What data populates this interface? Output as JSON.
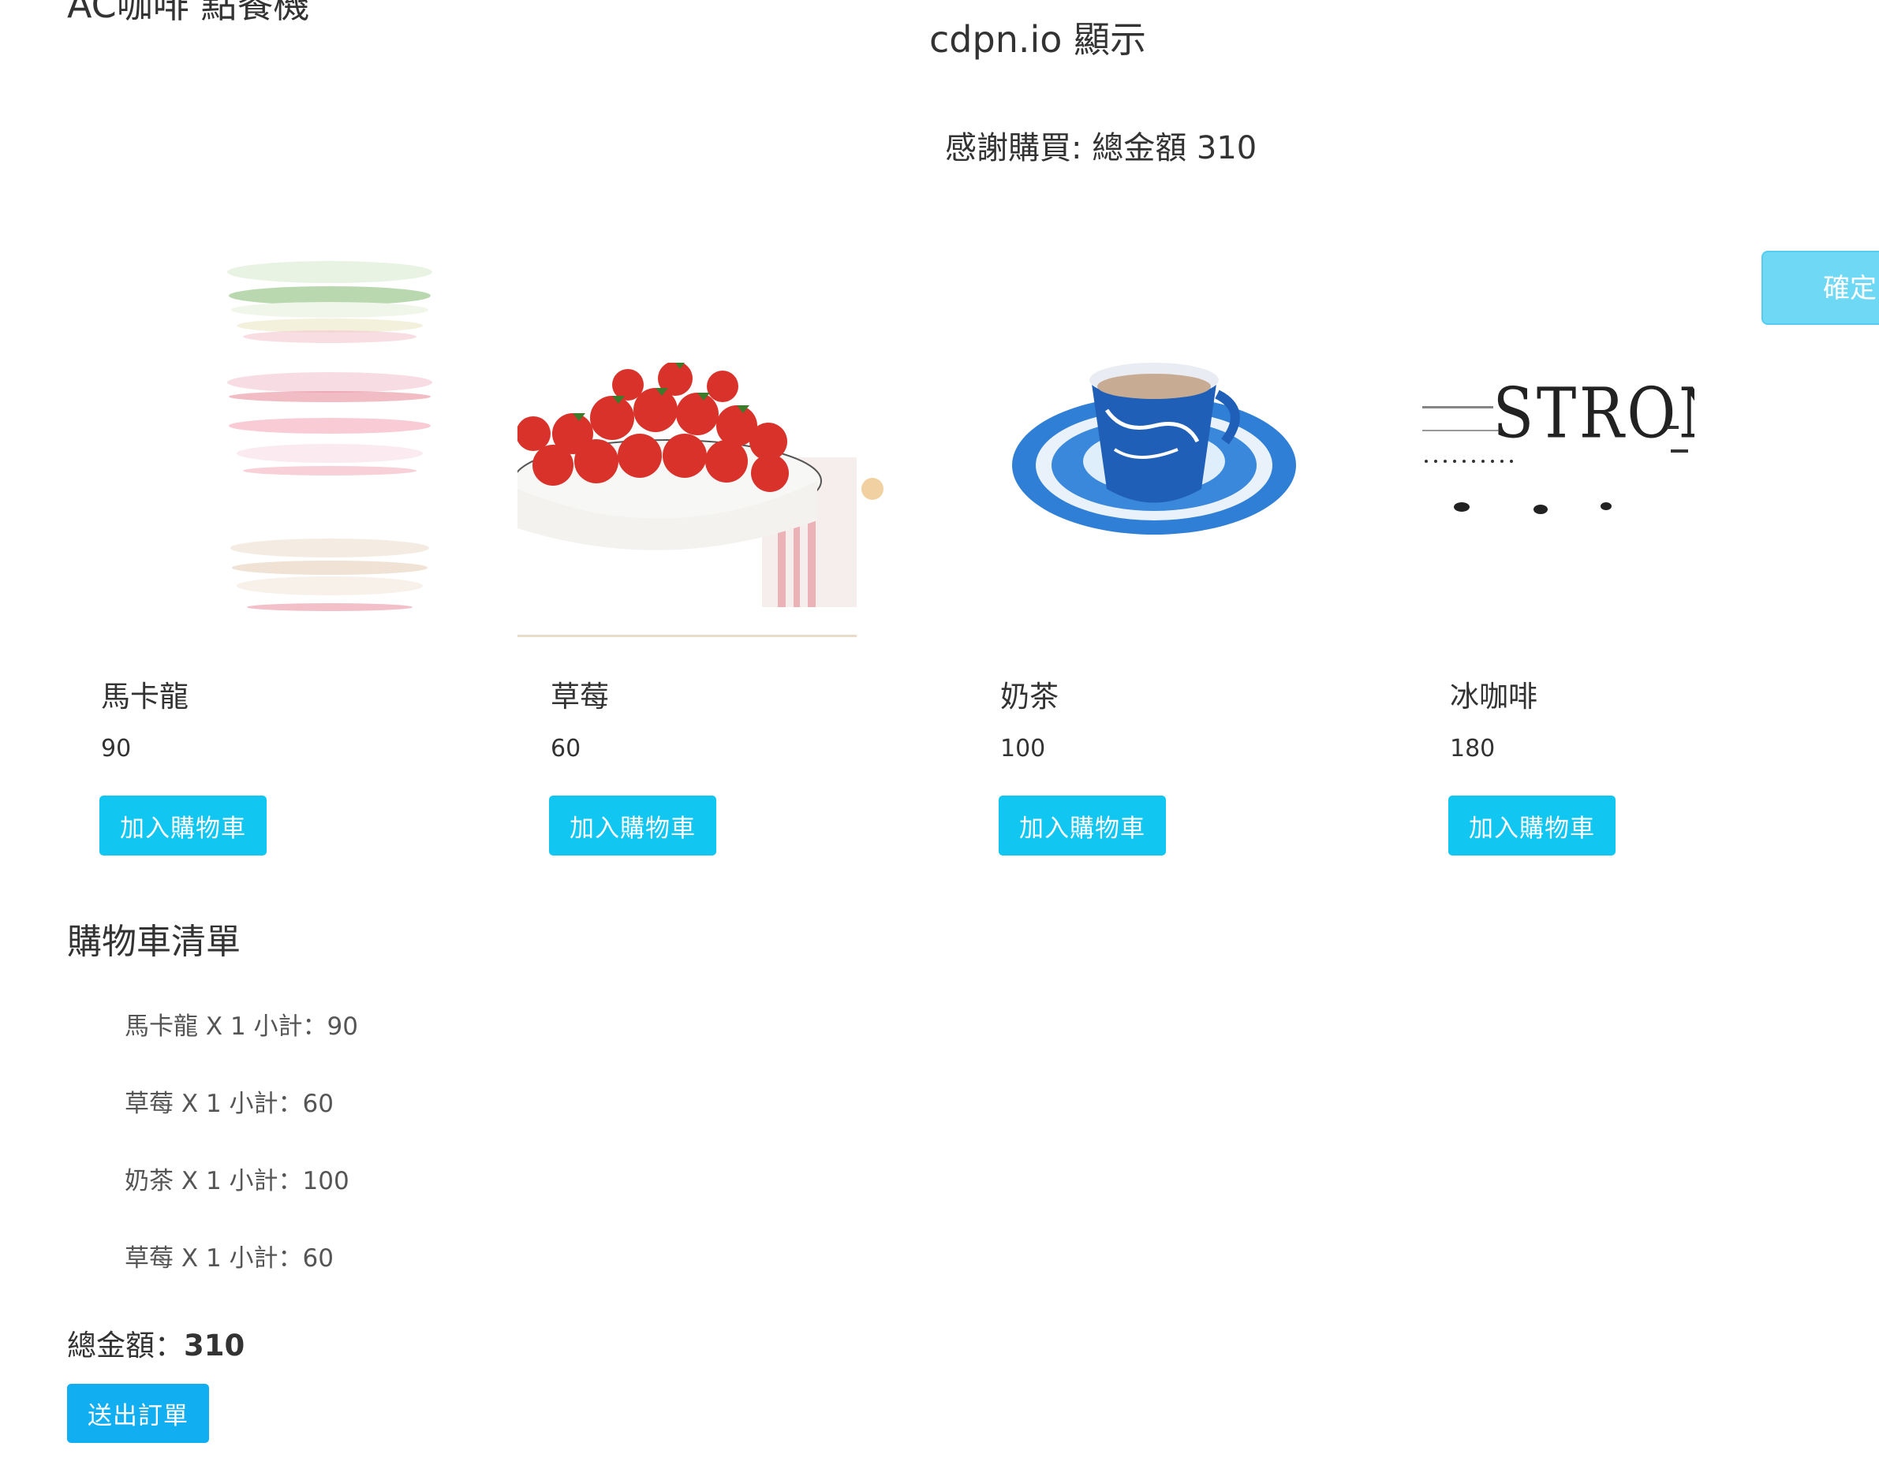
{
  "app": {
    "title": "AC咖啡 點餐機"
  },
  "alert": {
    "origin": "cdpn.io 顯示",
    "message": "感謝購買: 總金額 310",
    "ok_label": "確定"
  },
  "products": [
    {
      "name": "馬卡龍",
      "price": "90",
      "add_label": "加入購物車",
      "image": "macaron-photo"
    },
    {
      "name": "草莓",
      "price": "60",
      "add_label": "加入購物車",
      "image": "strawberry-photo"
    },
    {
      "name": "奶茶",
      "price": "100",
      "add_label": "加入購物車",
      "image": "milk-tea-photo"
    },
    {
      "name": "冰咖啡",
      "price": "180",
      "add_label": "加入購物車",
      "image": "iced-coffee-photo"
    }
  ],
  "cart": {
    "title": "購物車清單",
    "items": [
      "馬卡龍 X 1 小計：90",
      "草莓 X 1 小計：60",
      "奶茶 X 1 小計：100",
      "草莓 X 1 小計：60"
    ],
    "total_label": "總金額：",
    "total_value": "310",
    "submit_label": "送出訂單"
  },
  "colors": {
    "button": "#11c7f2",
    "submit_button": "#11aef2",
    "alert_button": "#6fd9f5",
    "text": "#333333"
  }
}
